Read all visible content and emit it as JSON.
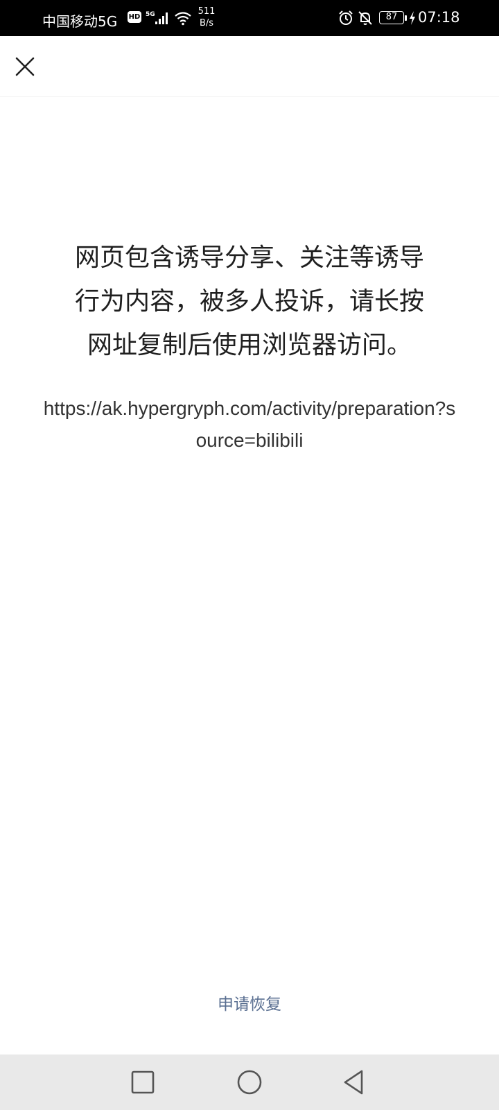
{
  "status_bar": {
    "carrier": "中国移动5G",
    "hd_badge": "HD",
    "net_speed_value": "511",
    "net_speed_unit": "B/s",
    "battery": "87",
    "time": "07:18",
    "icons": [
      "signal-icon",
      "wifi-icon",
      "alarm-icon",
      "mute-icon",
      "charging-icon"
    ]
  },
  "top_bar": {
    "close_icon": "close-icon"
  },
  "main": {
    "message_line1": "网页包含诱导分享、关注等诱导",
    "message_line2": "行为内容，被多人投诉，请长按",
    "message_line3": "网址复制后使用浏览器访问。",
    "url": "https://ak.hypergryph.com/activity/preparation?source=bilibili",
    "restore_link": "申请恢复"
  },
  "colors": {
    "status_bar_bg": "#000000",
    "link": "#5a6f91",
    "text": "#1f1f1f",
    "nav_bar_bg": "#e9e9e9"
  },
  "nav_bar": {
    "buttons": [
      "recent-apps-icon",
      "home-icon",
      "back-icon"
    ]
  }
}
